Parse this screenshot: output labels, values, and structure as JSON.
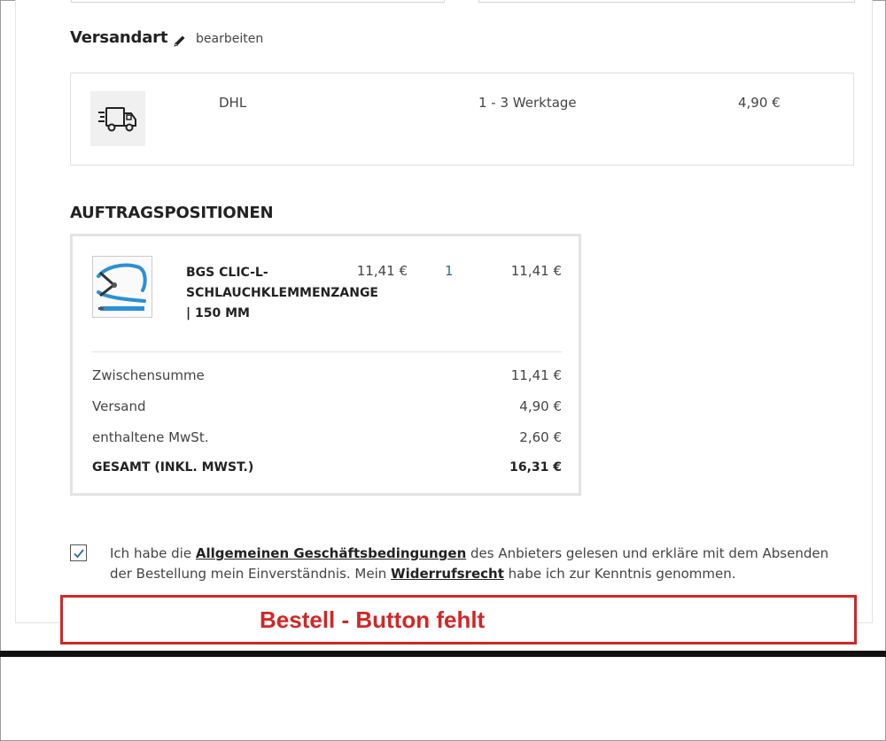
{
  "shipping": {
    "title": "Versandart",
    "edit_label": "bearbeiten",
    "method": {
      "name": "DHL",
      "delivery_time": "1 - 3 Werktage",
      "price": "4,90 €",
      "icon": "delivery-truck-icon"
    }
  },
  "positions": {
    "title": "AUFTRAGSPOSITIONEN",
    "items": [
      {
        "name": "BGS CLIC-L-SCHLAUCHKLEMMENZANGE | 150 MM",
        "unit_price": "11,41 €",
        "quantity": "1",
        "total": "11,41 €"
      }
    ],
    "summary": [
      {
        "label": "Zwischensumme",
        "value": "11,41 €"
      },
      {
        "label": "Versand",
        "value": "4,90 €"
      },
      {
        "label": "enthaltene MwSt.",
        "value": "2,60 €"
      },
      {
        "label": "GESAMT (INKL. MWST.)",
        "value": "16,31 €"
      }
    ]
  },
  "terms": {
    "checked": true,
    "text_1": "Ich habe die ",
    "link_1": "Allgemeinen Geschäftsbedingungen",
    "text_2": " des Anbieters gelesen und erkläre mit dem Absenden der Bestellung mein Einverständnis. Mein ",
    "link_2": "Widerrufsrecht",
    "text_3": " habe ich zur Kenntnis genommen."
  },
  "annotation": {
    "text": "Bestell - Button fehlt",
    "color": "#d32626"
  },
  "colors": {
    "quantity": "#2a6e8a",
    "annotation": "#d32626"
  }
}
